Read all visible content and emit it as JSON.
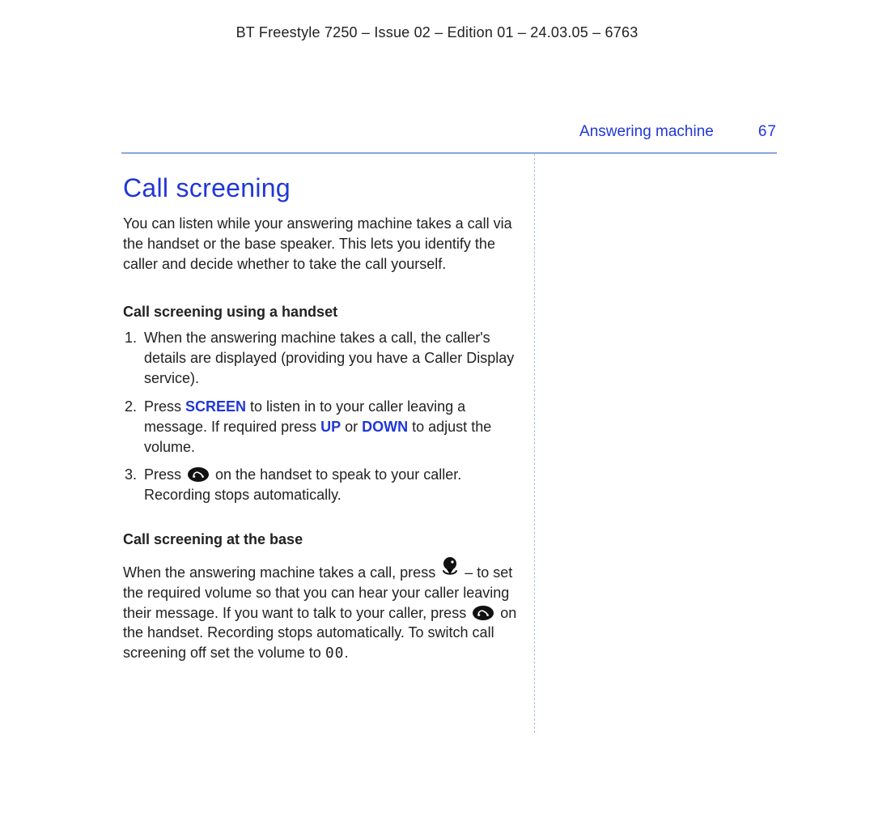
{
  "doc_id": "BT Freestyle 7250 – Issue 02 – Edition 01 – 24.03.05 – 6763",
  "running_head": {
    "section": "Answering machine",
    "page_number": "67"
  },
  "title": "Call screening",
  "intro": "You can listen while your answering machine takes a call via the handset or the base speaker. This lets you identify the caller and decide whether to take the call yourself.",
  "handset": {
    "heading": "Call screening using a handset",
    "step1": "When the answering machine takes a call, the caller's details are displayed (providing you have a Caller Display service).",
    "step2_a": "Press ",
    "step2_kw_screen": "SCREEN",
    "step2_b": " to listen in to your caller leaving a message. If required press ",
    "step2_kw_up": "UP",
    "step2_c": " or ",
    "step2_kw_down": "DOWN",
    "step2_d": " to adjust the volume.",
    "step3_a": "Press ",
    "step3_b": " on the handset to speak to your caller. Recording stops automatically."
  },
  "base": {
    "heading": "Call screening at the base",
    "a": "When the answering machine takes a call, press ",
    "b": " – to set the required volume so that you can hear your caller leaving their message. If you want to talk to your caller, press ",
    "c": " on the handset. Recording stops automatically. To switch call screening off set the volume to ",
    "zeros": "00",
    "d": "."
  }
}
